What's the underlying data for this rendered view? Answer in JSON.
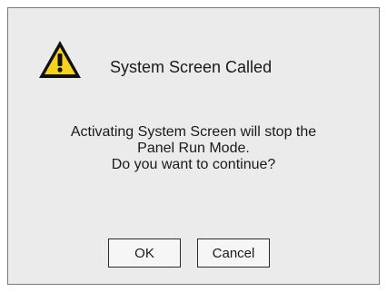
{
  "dialog": {
    "title": "System Screen Called",
    "icon": "warning-icon",
    "message_lines": [
      "Activating System Screen will stop the",
      "Panel Run Mode.",
      "Do you want to continue?"
    ],
    "buttons": {
      "ok_label": "OK",
      "cancel_label": "Cancel"
    }
  },
  "colors": {
    "dialog_background": "#ebebeb",
    "warning_yellow": "#f5d21c",
    "icon_outline": "#111111"
  }
}
